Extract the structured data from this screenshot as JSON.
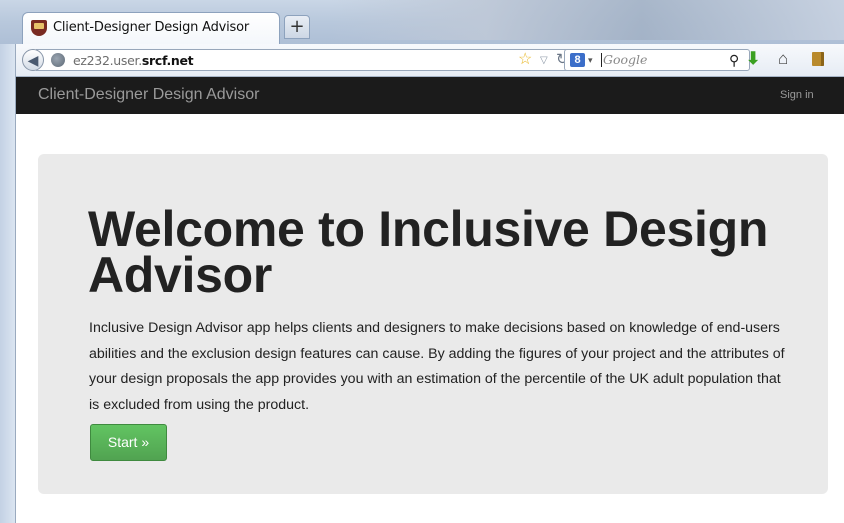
{
  "browser": {
    "tab_title": "Client-Designer Design Advisor",
    "new_tab_label": "+",
    "url_prefix": "ez232.user.",
    "url_domain": "srcf.net",
    "search_placeholder": "Google",
    "search_engine_icon": "8",
    "icons": {
      "back": "back-arrow-icon",
      "site": "globe-icon",
      "bookmark_star": "star-icon",
      "reload": "reload-icon",
      "search": "magnifier-icon",
      "downloads": "download-arrow-icon",
      "home": "home-icon",
      "bookmarks": "bookmarks-icon"
    }
  },
  "site": {
    "brand": "Client-Designer Design Advisor",
    "signin_label": "Sign in"
  },
  "hero": {
    "title": "Welcome to Inclusive Design Advisor",
    "description": "Inclusive Design Advisor app helps clients and designers to make decisions based on knowledge of end-users abilities and the exclusion design features can cause. By adding the figures of your project and the attributes of your design proposals the app provides you with an estimation of the percentile of the UK adult population that is excluded from using the product.",
    "start_label": "Start »"
  },
  "colors": {
    "navbar_bg": "#1b1b1b",
    "hero_bg": "#eaeaea",
    "start_button": "#5bb75b"
  }
}
